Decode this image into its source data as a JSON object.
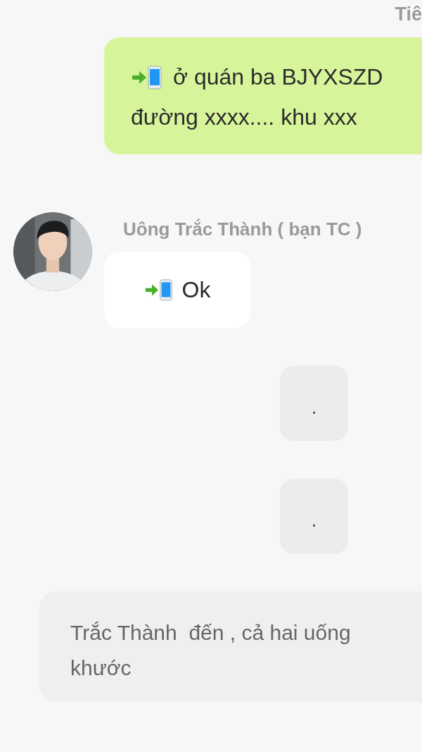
{
  "messages": [
    {
      "kind": "sent",
      "sender": "Tiê",
      "lines": [
        "ở quán ba BJYXSZD",
        "đường xxxx.... khu xxx"
      ]
    },
    {
      "kind": "received",
      "sender": "Uông Trắc Thành ( bạn TC )",
      "lines": [
        "Ok"
      ]
    },
    {
      "kind": "dot",
      "lines": [
        "."
      ]
    },
    {
      "kind": "dot",
      "lines": [
        "."
      ]
    },
    {
      "kind": "narration",
      "lines": [
        "Trắc Thành  đến , cả hai uống",
        "khước"
      ]
    }
  ]
}
